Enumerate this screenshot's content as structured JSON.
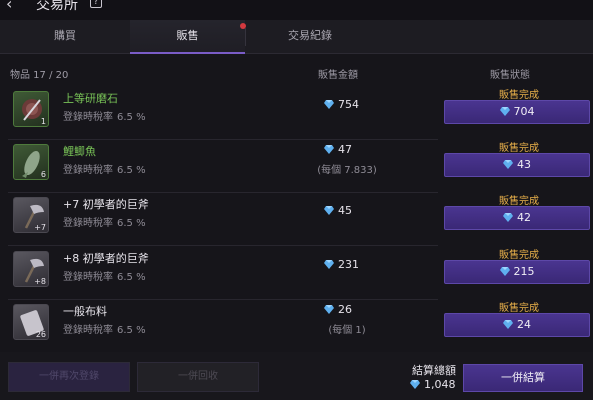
{
  "header": {
    "title": "交易所",
    "back_icon": "back-arrow-icon",
    "help_icon": "help-book-icon"
  },
  "tabs": [
    {
      "label": "購買"
    },
    {
      "label": "販售"
    },
    {
      "label": "交易紀錄"
    }
  ],
  "columns": {
    "items": "物品 17 / 20",
    "price": "販售金額",
    "status": "販售狀態"
  },
  "rows": [
    {
      "name": "上等研磨石",
      "name_color": "#78c257",
      "qty": "1",
      "tax_label": "登錄時稅率",
      "tax": "6.5 %",
      "price": "754",
      "each": "",
      "status": "販售完成",
      "sell": "704",
      "icon": "grindstone-icon"
    },
    {
      "name": "鯉鯽魚",
      "name_color": "#78c257",
      "qty": "6",
      "tax_label": "登錄時稅率",
      "tax": "6.5 %",
      "price": "47",
      "each": "(每個 7.833)",
      "status": "販售完成",
      "sell": "43",
      "icon": "fish-icon"
    },
    {
      "name": "+7 初學者的巨斧",
      "name_color": "#e6e3ea",
      "qty": "+7",
      "tax_label": "登錄時稅率",
      "tax": "6.5 %",
      "price": "45",
      "each": "",
      "status": "販售完成",
      "sell": "42",
      "icon": "axe-icon"
    },
    {
      "name": "+8 初學者的巨斧",
      "name_color": "#e6e3ea",
      "qty": "+8",
      "tax_label": "登錄時稅率",
      "tax": "6.5 %",
      "price": "231",
      "each": "",
      "status": "販售完成",
      "sell": "215",
      "icon": "axe-icon"
    },
    {
      "name": "一般布料",
      "name_color": "#e6e3ea",
      "qty": "26",
      "tax_label": "登錄時稅率",
      "tax": "6.5 %",
      "price": "26",
      "each": "(每個 1)",
      "status": "販售完成",
      "sell": "24",
      "icon": "cloth-icon"
    }
  ],
  "footer": {
    "reregister": "一併再次登錄",
    "retrieve": "一併回收",
    "total_label": "結算總額",
    "total_value": "1,048",
    "settle": "一併結算"
  },
  "colors": {
    "accent": "#4a3590",
    "gem": "#5fb0ef",
    "status": "#e8b04a",
    "tab_dot": "#d3393f"
  }
}
